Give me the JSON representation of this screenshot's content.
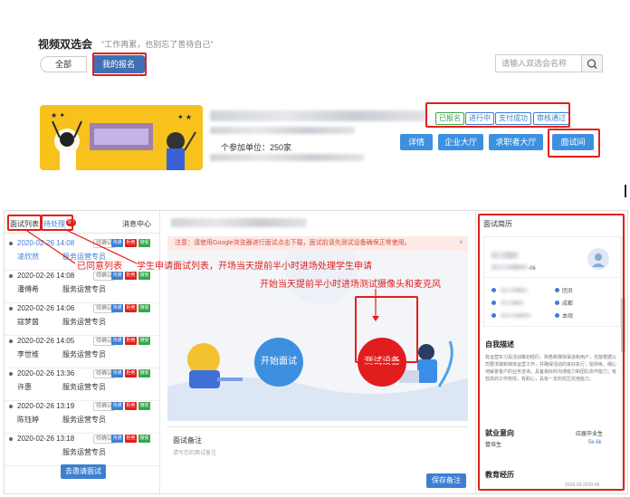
{
  "top": {
    "title": "视频双选会",
    "slogan": "\"工作再累，也别忘了善待自己\"",
    "filter_all": "全部",
    "filter_mine": "我的报名",
    "search_placeholder": "请输入双选会名称",
    "tags": [
      "已报名",
      "进行中",
      "支付成功",
      "审核通过"
    ],
    "buttons": [
      "详情",
      "企业大厅",
      "求职者大厅",
      "面试间"
    ],
    "participants": "个参加单位：250家"
  },
  "left": {
    "tab_list": "面试列表",
    "tab_pending": "待处理",
    "pending_badge": "59",
    "msg_center": "消息中心",
    "status_label": "待确认",
    "mini_labels": [
      "沟通",
      "拒绝",
      "接受"
    ],
    "rows": [
      {
        "date": "2020-02-26 14:08",
        "name": "凌欣然",
        "role": "服务运营专员"
      },
      {
        "date": "2020-02-26 14:08",
        "name": "潘傅希",
        "role": "服务运营专员"
      },
      {
        "date": "2020-02-26 14:06",
        "name": "寇梦茵",
        "role": "服务运营专员"
      },
      {
        "date": "2020-02-26 14:05",
        "name": "李世维",
        "role": "服务运营专员"
      },
      {
        "date": "2020-02-26 13:36",
        "name": "许惠",
        "role": "服务运营专员"
      },
      {
        "date": "2020-02-26 13:19",
        "name": "陈钰婷",
        "role": "服务运营专员"
      },
      {
        "date": "2020-02-26 13:18",
        "name": "",
        "role": "服务运营专员"
      }
    ],
    "invite_button": "去邀请面试"
  },
  "mid": {
    "notice": "注意：请使用Google浏览器进行面试点击下载，面试前请先测试设备确保正常使用。",
    "start_button": "开始面试",
    "test_button": "测试设备",
    "remark_title": "面试备注",
    "remark_placeholder": "请写您的面试备注",
    "save_button": "保存备注"
  },
  "right": {
    "title": "面试简历",
    "id_suffix": "-06",
    "info_labels": [
      "团员",
      "成都",
      "本硕"
    ],
    "self_desc_title": "自我描述",
    "self_desc": "有运营实习及活动策划经历，熟悉新媒体渠道和用户，也能根据公司要求做新媒体运营工作，并确保活动的良好执行；能熟练、细心地解答客户的业务咨询，具备良好的沟通能力和团队协作能力；有较高的工作热情，有耐心，具有一定的抗压抗挫能力。",
    "intent_title": "就业意向",
    "intent_role": "管培生",
    "intent_type": "应届毕业生",
    "intent_salary": "5k-6k",
    "edu_title": "教育经历",
    "edu_date": "2016-09-2020-06"
  },
  "annotations": {
    "agreed_list": "已同意列表",
    "student_apply": "学生申请面试列表，开场当天提前半小时进场处理学生申请",
    "test_hint": "开始当天提前半小时进场测试摄像头和麦克风"
  },
  "colors": {
    "accent": "#3d90e0",
    "annotation": "#e0201b",
    "banner": "#f6c21b"
  }
}
